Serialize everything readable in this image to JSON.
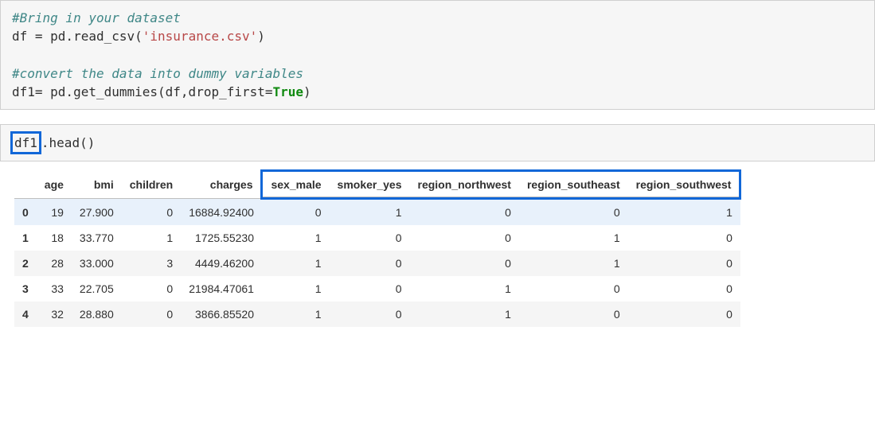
{
  "cell1": {
    "line1_comment": "#Bring in your dataset",
    "line2_a": "df = pd.read_csv(",
    "line2_str": "'insurance.csv'",
    "line2_b": ")",
    "line4_comment": "#convert the data into dummy variables",
    "line5_a": "df1= pd.get_dummies(df,drop_first=",
    "line5_kw": "True",
    "line5_b": ")"
  },
  "cell2": {
    "code_pre": "df1",
    "code_post": ".head()"
  },
  "table": {
    "columns": [
      "age",
      "bmi",
      "children",
      "charges",
      "sex_male",
      "smoker_yes",
      "region_northwest",
      "region_southeast",
      "region_southwest"
    ],
    "highlight_from_col": 4,
    "rows": [
      {
        "idx": "0",
        "vals": [
          "19",
          "27.900",
          "0",
          "16884.92400",
          "0",
          "1",
          "0",
          "0",
          "1"
        ],
        "selected": true
      },
      {
        "idx": "1",
        "vals": [
          "18",
          "33.770",
          "1",
          "1725.55230",
          "1",
          "0",
          "0",
          "1",
          "0"
        ]
      },
      {
        "idx": "2",
        "vals": [
          "28",
          "33.000",
          "3",
          "4449.46200",
          "1",
          "0",
          "0",
          "1",
          "0"
        ]
      },
      {
        "idx": "3",
        "vals": [
          "33",
          "22.705",
          "0",
          "21984.47061",
          "1",
          "0",
          "1",
          "0",
          "0"
        ]
      },
      {
        "idx": "4",
        "vals": [
          "32",
          "28.880",
          "0",
          "3866.85520",
          "1",
          "0",
          "1",
          "0",
          "0"
        ]
      }
    ]
  }
}
